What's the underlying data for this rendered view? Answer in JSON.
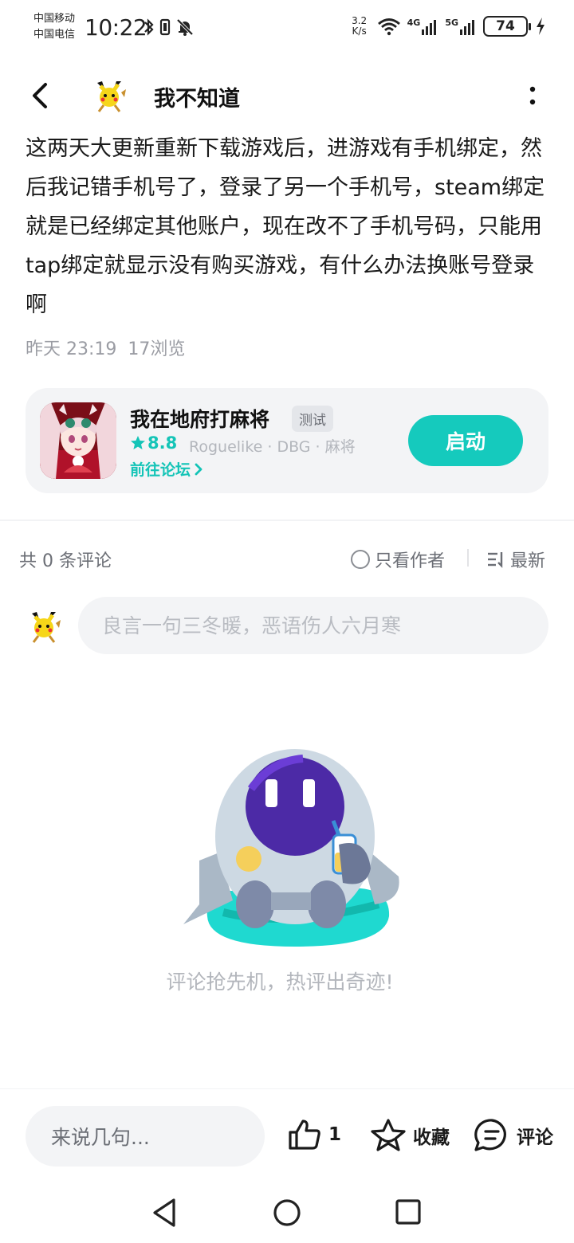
{
  "status_bar": {
    "carrier1": "中国移动",
    "carrier2": "中国电信",
    "time": "10:22",
    "net_speed_value": "3.2",
    "net_speed_unit": "K/s",
    "network1": "4G",
    "network2": "5G",
    "battery": "74"
  },
  "header": {
    "author": "我不知道"
  },
  "post": {
    "content": "这两天大更新重新下载游戏后，进游戏有手机绑定，然后我记错手机号了，登录了另一个手机号，steam绑定就是已经绑定其他账户，现在改不了手机号码，只能用tap绑定就显示没有购买游戏，有什么办法换账号登录啊",
    "date": "昨天 23:19",
    "views": "17浏览"
  },
  "game_card": {
    "title": "我在地府打麻将",
    "tag": "测试",
    "rating": "8.8",
    "genres": "Roguelike · DBG · 麻将",
    "forum_link": "前往论坛",
    "launch_label": "启动",
    "accent": "#15cabd"
  },
  "comments": {
    "count_label": "共 0 条评论",
    "author_only": "只看作者",
    "sort": "最新",
    "input_placeholder": "良言一句三冬暖，恶语伤人六月寒",
    "empty_text": "评论抢先机，热评出奇迹!"
  },
  "bottom_bar": {
    "quick_input": "来说几句...",
    "like_count": "1",
    "favorite_label": "收藏",
    "comment_label": "评论"
  },
  "icons": {
    "back": "chevron-left-icon",
    "more": "more-vertical-icon",
    "like": "thumb-up-icon",
    "favorite": "star-icon",
    "comment": "chat-bubble-icon"
  }
}
